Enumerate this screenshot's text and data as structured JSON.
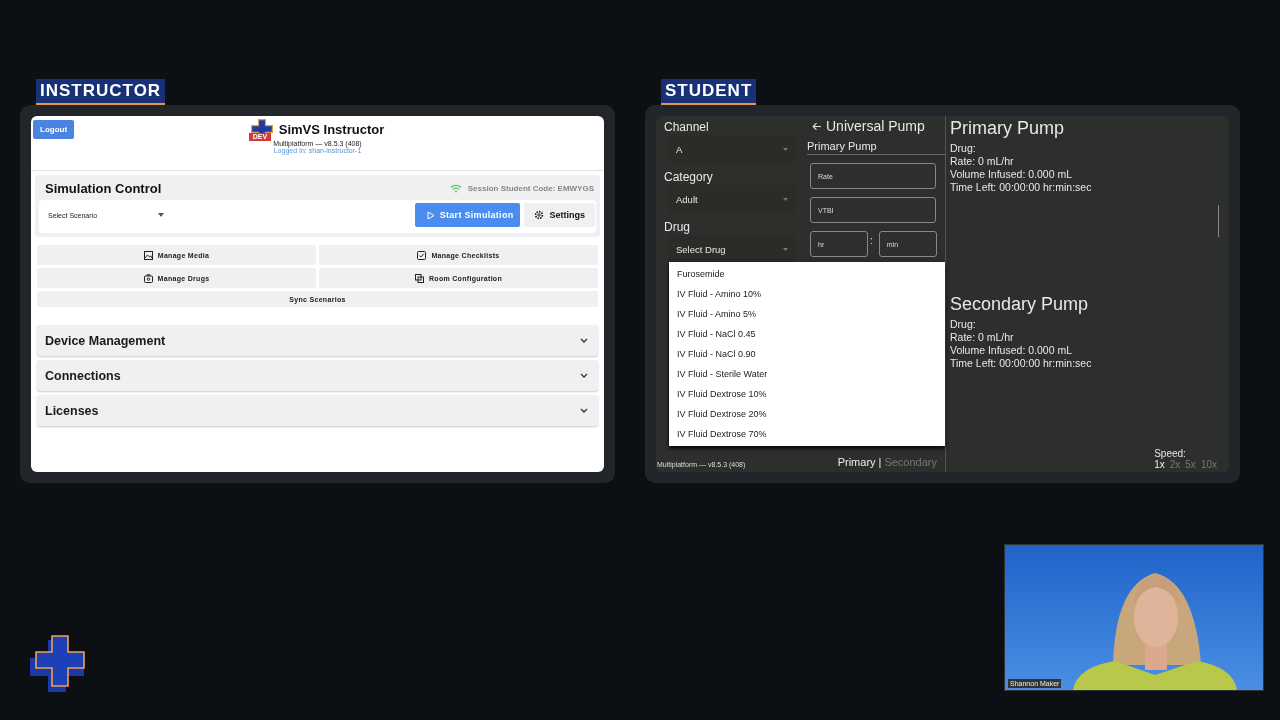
{
  "instructor_label": "INSTRUCTOR",
  "student_label": "STUDENT",
  "instructor": {
    "logout": "Logout",
    "app_title": "SimVS Instructor",
    "logo_badge": "DEV",
    "version": "Multiplatform — v8.5.3 (408)",
    "logged_in": "Logged In: shan-instructor-1",
    "simulation_control": {
      "title": "Simulation Control",
      "session_code": "Session Student Code: EMWYGS",
      "scenario_select": {
        "placeholder": "Select Scenario"
      },
      "start_button": "Start Simulation",
      "settings_button": "Settings"
    },
    "actions": [
      "Manage Media",
      "Manage Checklists",
      "Manage Drugs",
      "Room Configuration"
    ],
    "sync_button": "Sync Scenarios",
    "sections": [
      {
        "title": "Device Management",
        "expanded": false
      },
      {
        "title": "Connections",
        "expanded": false
      },
      {
        "title": "Licenses",
        "expanded": false
      }
    ]
  },
  "student": {
    "fields": [
      {
        "label": "Channel",
        "value": "A"
      },
      {
        "label": "Category",
        "value": "Adult"
      },
      {
        "label": "Drug",
        "value": "Select Drug"
      }
    ],
    "dropdown_items": [
      "Furosemide",
      "IV Fluid - Amino 10%",
      "IV Fluid - Amino 5%",
      "IV Fluid - NaCl 0.45",
      "IV Fluid - NaCl 0.90",
      "IV Fluid - Sterile Water",
      "IV Fluid Dextrose 10%",
      "IV Fluid Dextrose 20%",
      "IV Fluid Dextrose 70%"
    ],
    "pump_title": "Universal Pump",
    "pump_subtitle": "Primary Pump",
    "inputs": {
      "rate": {
        "placeholder": "Rate"
      },
      "vtbi": {
        "placeholder": "VTBI"
      },
      "hours": {
        "placeholder": "hr"
      },
      "separator": ":",
      "minutes": {
        "placeholder": "min"
      }
    },
    "pump_tabs": [
      {
        "label": "Primary",
        "selected": true
      },
      {
        "label": "Secondary",
        "selected": false
      }
    ],
    "tab_separator": "|",
    "version": "Multiplatform — v8.5.3 (408)",
    "pumps": [
      {
        "title": "Primary Pump",
        "lines": [
          "Drug:",
          "Rate: 0 mL/hr",
          "Volume Infused: 0.000 mL",
          "Time Left: 00:00:00 hr:min:sec"
        ]
      },
      {
        "title": "Secondary Pump",
        "lines": [
          "Drug:",
          "Rate: 0 mL/hr",
          "Volume Infused: 0.000 mL",
          "Time Left: 00:00:00 hr:min:sec"
        ]
      }
    ],
    "speed_label": "Speed:",
    "speeds": [
      {
        "label": "1x",
        "selected": true
      },
      {
        "label": "2x",
        "selected": false
      },
      {
        "label": "5x",
        "selected": false
      },
      {
        "label": "10x",
        "selected": false
      }
    ]
  },
  "video": {
    "kind": "picture",
    "name_tag": "Shannon Maker"
  }
}
